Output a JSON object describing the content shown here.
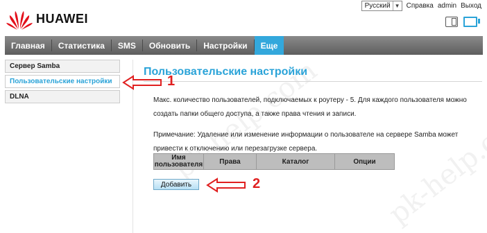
{
  "brand": {
    "name": "HUAWEI"
  },
  "topbar": {
    "language_selected": "Русский",
    "help_label": "Справка",
    "user_label": "admin",
    "logout_label": "Выход"
  },
  "nav": {
    "items": [
      "Главная",
      "Статистика",
      "SMS",
      "Обновить",
      "Настройки",
      "Еще"
    ],
    "active_index": 5
  },
  "sidebar": {
    "items": [
      "Сервер Samba",
      "Пользовательские настройки",
      "DLNA"
    ],
    "active_index": 1
  },
  "main": {
    "title": "Пользовательские настройки",
    "description": "Макс. количество пользователей, подключаемых к роутеру - 5. Для каждого пользователя можно создать папки общего доступа, а также права чтения и записи.",
    "note": "Примечание: Удаление или изменение информации о пользователе на сервере Samba может привести к отключению или перезагрузке сервера.",
    "table_headers": [
      "Имя пользователя",
      "Права",
      "Каталог",
      "Опции"
    ],
    "add_button_label": "Добавить"
  },
  "annotations": [
    "1",
    "2"
  ],
  "watermark": "pk-help.com",
  "colors": {
    "accent": "#2aa3d8",
    "nav_bg": "#6e6e6e",
    "annotation": "#e02020",
    "brand_red": "#e3101b"
  },
  "icons": [
    "huawei-logo",
    "sim-card-icon",
    "monitor-icon",
    "dropdown-arrow-icon"
  ]
}
